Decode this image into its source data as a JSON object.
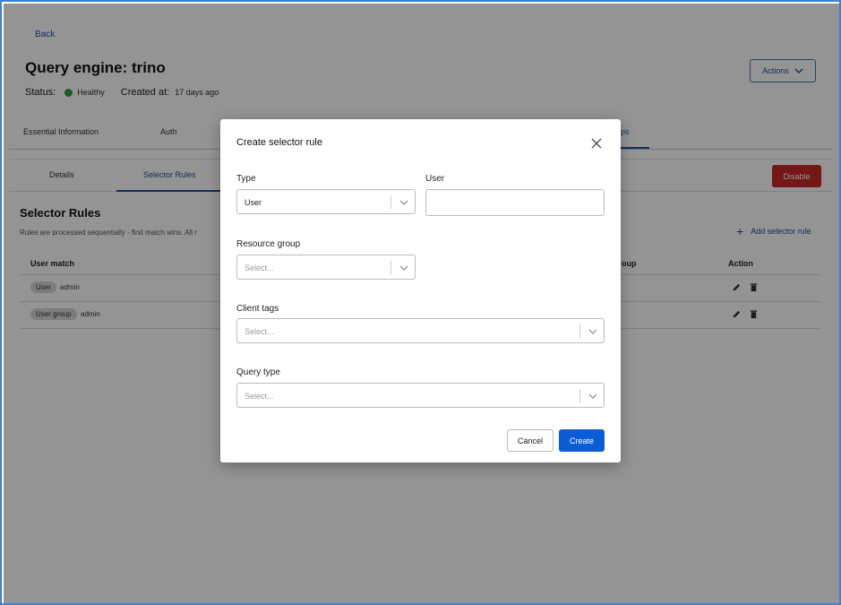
{
  "header": {
    "back_label": "Back",
    "title": "Query engine: trino",
    "status_label": "Status:",
    "status_value": "Healthy",
    "created_label": "Created at:",
    "created_value": "17 days ago",
    "actions_label": "Actions"
  },
  "main_tabs": {
    "essential": "Essential Information",
    "auth": "Auth",
    "partial_right": "ps"
  },
  "sub_tabs": {
    "details": "Details",
    "selector_rules": "Selector Rules",
    "disable_label": "Disable"
  },
  "section": {
    "title": "Selector Rules",
    "description": "Rules are processed sequentially - first match wins. All r",
    "add_label": "Add selector rule"
  },
  "table": {
    "headers": {
      "user_match": "User match",
      "group_partial": "oup",
      "action": "Action"
    },
    "rows": [
      {
        "chip": "User",
        "value": "admin"
      },
      {
        "chip": "User group",
        "value": "admin"
      }
    ]
  },
  "modal": {
    "title": "Create selector rule",
    "type_label": "Type",
    "type_value": "User",
    "user_label": "User",
    "user_value": "",
    "resource_group_label": "Resource group",
    "resource_group_placeholder": "Select...",
    "client_tags_label": "Client tags",
    "client_tags_placeholder": "Select...",
    "query_type_label": "Query type",
    "query_type_placeholder": "Select...",
    "cancel_label": "Cancel",
    "create_label": "Create"
  },
  "colors": {
    "accent": "#0b5cd5",
    "link": "#1f4fa3",
    "danger": "#c62828",
    "healthy": "#2ea043"
  }
}
